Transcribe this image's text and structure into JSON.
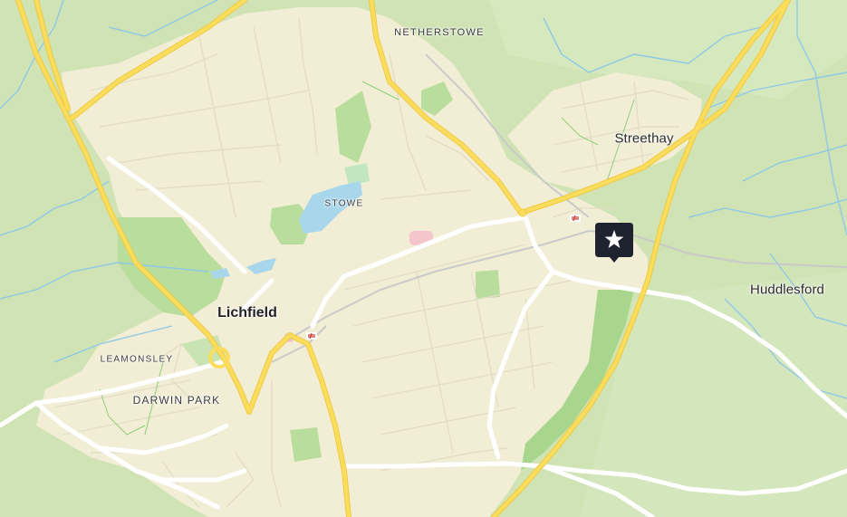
{
  "map": {
    "colors": {
      "background": "#cfe3b4",
      "urban": "#f2eed6",
      "park": "#b9dd9c",
      "water": "#a8d7ec",
      "stream": "#8fc8e6",
      "minor_road": "#e4ddc5",
      "main_road": "#ffffff",
      "major_road": "#fbdd5e",
      "major_road_casing": "#f0c942",
      "rail": "#c9c9c9",
      "marker": "#1f2330",
      "poi": "#f4c6cc"
    },
    "labels": {
      "netherstowe": "NETHERSTOWE",
      "streethay": "Streethay",
      "stowe": "STOWE",
      "huddlesford": "Huddlesford",
      "lichfield": "Lichfield",
      "leamonsley": "LEAMONSLEY",
      "darwin_park": "DARWIN PARK"
    },
    "marker": {
      "icon": "star-icon"
    },
    "stations": [
      "rail-station-icon",
      "rail-station-icon"
    ]
  }
}
